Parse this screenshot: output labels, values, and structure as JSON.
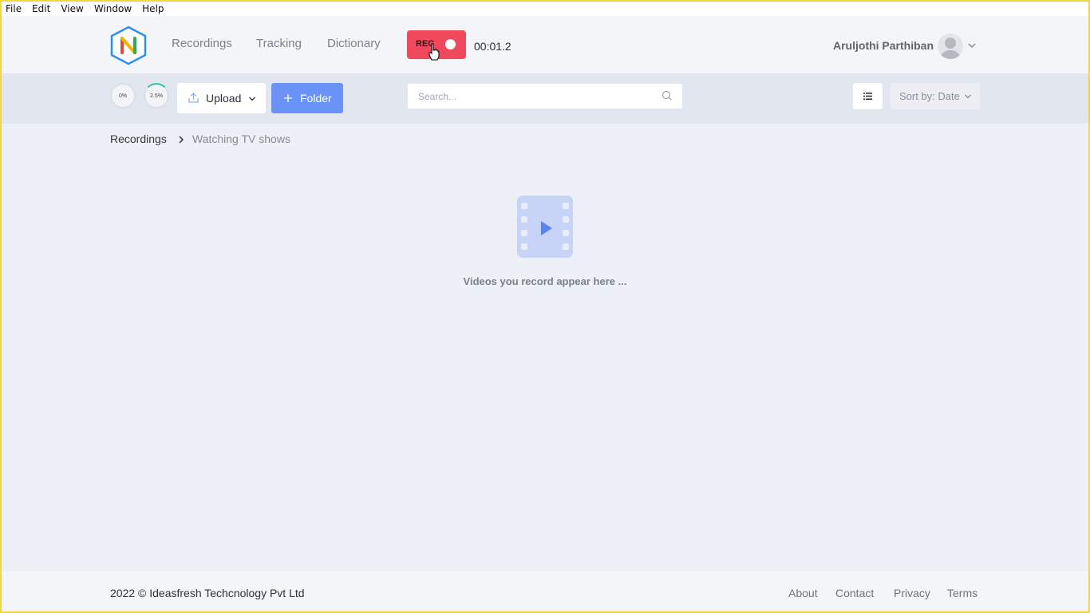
{
  "menubar": {
    "items": [
      "File",
      "Edit",
      "View",
      "Window",
      "Help"
    ]
  },
  "nav": {
    "links": [
      "Recordings",
      "Tracking",
      "Dictionary"
    ],
    "rec_label": "REC",
    "timer": "00:01.2",
    "user_name": "Aruljothi Parthiban"
  },
  "toolbar": {
    "progress_1": "0%",
    "progress_2": "2.5%",
    "upload_label": "Upload",
    "folder_label": "Folder",
    "search_placeholder": "Search...",
    "sort_label": "Sort by: Date"
  },
  "breadcrumb": {
    "root": "Recordings",
    "current": "Watching TV shows"
  },
  "empty_state": {
    "message": "Videos you record appear here ..."
  },
  "footer": {
    "copyright": "2022 © Ideasfresh Techcnology Pvt Ltd",
    "links": [
      "About",
      "Contact",
      "Privacy",
      "Terms"
    ]
  },
  "colors": {
    "accent_blue": "#6b93f7",
    "rec_red": "#f0485c",
    "logo_blue": "#2c8ff0"
  },
  "icons": [
    "logo-icon",
    "cursor-icon",
    "avatar-icon",
    "chevron-down-icon",
    "upload-icon",
    "plus-icon",
    "search-icon",
    "list-view-icon",
    "chevron-right-icon",
    "video-file-icon"
  ]
}
